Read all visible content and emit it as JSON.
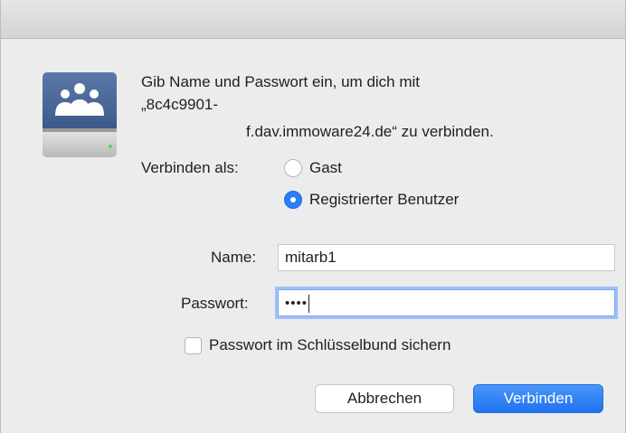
{
  "dialog": {
    "message": {
      "line1": "Gib Name und Passwort ein, um dich mit",
      "line2": "„8c4c9901-",
      "line3": "f.dav.immoware24.de“ zu verbinden."
    },
    "connect_as": {
      "label": "Verbinden als:",
      "options": [
        {
          "label": "Gast",
          "selected": false
        },
        {
          "label": "Registrierter Benutzer",
          "selected": true
        }
      ]
    },
    "name": {
      "label": "Name:",
      "value": "mitarb1"
    },
    "password": {
      "label": "Passwort:",
      "value": "••••"
    },
    "keychain": {
      "label": "Passwort im Schlüsselbund sichern",
      "checked": false
    },
    "buttons": {
      "cancel": "Abbrechen",
      "connect": "Verbinden"
    },
    "icons": {
      "server": "network-drive-icon"
    },
    "colors": {
      "accent": "#2a7ef5",
      "background": "#ececec"
    }
  }
}
